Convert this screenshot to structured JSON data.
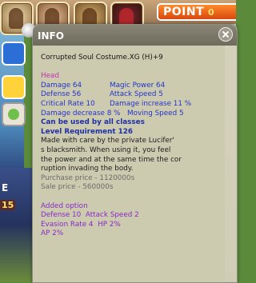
{
  "hud": {
    "point_label": "POINT",
    "point_value": "0",
    "scene_letter": "E",
    "scene_number": "15"
  },
  "tooltip": {
    "title": "INFO",
    "item_name": "Corrupted Soul Costume.XG (H)+9",
    "section_label": "Head",
    "stats": [
      [
        "Damage 64",
        "Magic Power 64"
      ],
      [
        "Defense 56",
        "Attack Speed 5"
      ],
      [
        "Critical Rate 10",
        "Damage increase 11 %"
      ],
      [
        "Damage decrease 8 %",
        "Moving Speed 5"
      ]
    ],
    "class_restriction": "Can be used by all classes",
    "level_requirement": "Level Requirement 126",
    "description": [
      "Made with care by the private Lucifer'",
      "s blacksmith. When using it, you feel",
      "the power and at the same time the cor",
      "ruption invading the body."
    ],
    "purchase_price": "Purchase price - 1120000s",
    "sale_price": "Sale price - 560000s",
    "added_option_label": "Added option",
    "added_options": [
      [
        "Defense 10",
        "Attack Speed 2"
      ],
      [
        "Evasion Rate 4",
        "HP 2%"
      ],
      [
        "AP 2%",
        ""
      ]
    ]
  }
}
